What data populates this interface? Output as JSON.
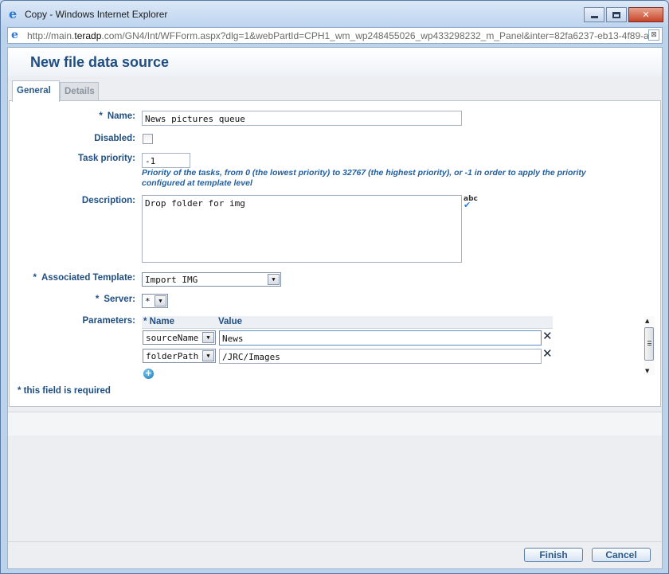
{
  "window": {
    "title": "Copy - Windows Internet Explorer",
    "address_prefix": "http://main.",
    "address_host": "teradp",
    "address_rest": ".com/GN4/Int/WFForm.aspx?dlg=1&webPartId=CPH1_wm_wp248455026_wp433298232_m_Panel&inter=82fa6237-eb13-4f89-a3!"
  },
  "page": {
    "title": "New file data source"
  },
  "tabs": [
    {
      "label": "General"
    },
    {
      "label": "Details"
    }
  ],
  "form": {
    "required_marker": "*",
    "name_label": "Name:",
    "name_value": "News pictures queue",
    "disabled_label": "Disabled:",
    "task_priority_label": "Task priority:",
    "task_priority_value": "-1",
    "task_priority_hint_line1": "Priority of the tasks, from 0 (the lowest priority) to 32767 (the highest priority), or -1 in order to apply the priority",
    "task_priority_hint_line2": "configured at template level",
    "description_label": "Description:",
    "description_value": "Drop folder for img",
    "spell_label": "abc",
    "associated_template_label": "Associated Template:",
    "associated_template_value": "Import IMG",
    "server_label": "Server:",
    "server_value": "*",
    "parameters_label": "Parameters:",
    "param_name_header": "* Name",
    "param_value_header": "Value",
    "parameters": [
      {
        "name": "sourceName",
        "value": "News"
      },
      {
        "name": "folderPath",
        "value": "/JRC/Images"
      }
    ],
    "required_note": "* this field is required"
  },
  "buttons": {
    "finish": "Finish",
    "cancel": "Cancel"
  }
}
